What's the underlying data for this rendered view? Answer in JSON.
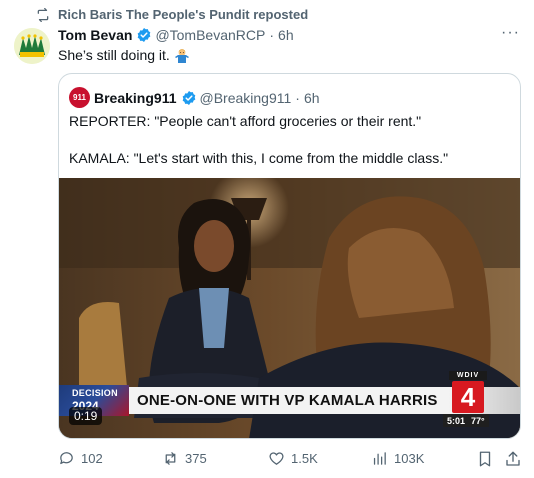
{
  "repost": {
    "text": "Rich Baris The People's Pundit reposted",
    "icon": "repost-icon"
  },
  "tweet": {
    "author_name": "Tom Bevan",
    "handle": "@TomBevanRCP",
    "separator": "·",
    "time": "6h",
    "text": "She’s still doing it.",
    "emoji": "man-shrugging-emoji",
    "more_icon": "more-icon",
    "more_label": "···"
  },
  "quote": {
    "avatar_label": "911",
    "author_name": "Breaking911",
    "handle": "@Breaking911",
    "separator": "·",
    "time": "6h",
    "line1": "REPORTER: \"People can't afford groceries or their rent.\"",
    "line2": "KAMALA: \"Let's start with this, I come from the middle class.\"",
    "video": {
      "duration": "0:19",
      "decision_line1": "DECISION",
      "decision_line2": "2024",
      "banner": "ONE-ON-ONE WITH VP KAMALA HARRIS",
      "station_call": "WDIV",
      "station_number": "4",
      "clock_time": "5:01",
      "temperature": "77°"
    }
  },
  "actions": {
    "replies": "102",
    "reposts": "375",
    "likes": "1.5K",
    "views": "103K"
  },
  "colors": {
    "text_primary": "#0f1419",
    "text_secondary": "#536471",
    "verified": "#1d9bf0",
    "border": "#cfd9de",
    "station_red": "#d71920"
  }
}
